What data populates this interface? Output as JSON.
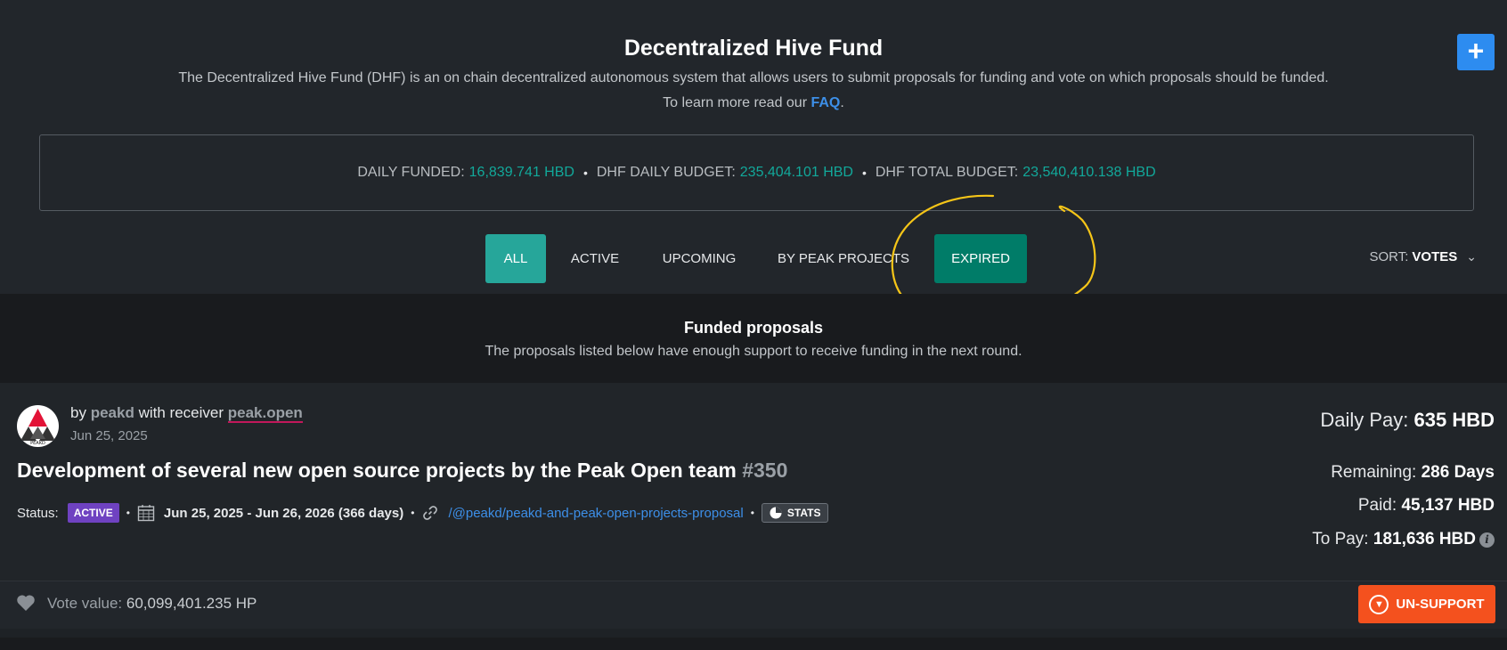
{
  "header": {
    "title": "Decentralized Hive Fund",
    "description": "The Decentralized Hive Fund (DHF) is an on chain decentralized autonomous system that allows users to submit proposals for funding and vote on which proposals should be funded.",
    "learn_prefix": "To learn more read our",
    "faq_label": "FAQ",
    "learn_suffix": ".",
    "add_label": "+"
  },
  "budget": {
    "daily_funded_label": "DAILY FUNDED:",
    "daily_funded_value": "16,839.741 HBD",
    "daily_budget_label": "DHF DAILY BUDGET:",
    "daily_budget_value": "235,404.101 HBD",
    "total_budget_label": "DHF TOTAL BUDGET:",
    "total_budget_value": "23,540,410.138 HBD",
    "separator": "•"
  },
  "tabs": {
    "all": "ALL",
    "active": "ACTIVE",
    "upcoming": "UPCOMING",
    "peak": "BY PEAK PROJECTS",
    "expired": "EXPIRED"
  },
  "sort": {
    "label": "SORT:",
    "value": "VOTES"
  },
  "funded": {
    "title": "Funded proposals",
    "description": "The proposals listed below have enough support to receive funding in the next round."
  },
  "proposal": {
    "by": "by",
    "author": "peakd",
    "with_receiver": "with receiver",
    "receiver": "peak.open",
    "date": "Jun 25, 2025",
    "title": "Development of several new open source projects by the Peak Open team",
    "number": "#350",
    "status_label": "Status:",
    "status": "ACTIVE",
    "date_range": "Jun 25, 2025 - Jun 26, 2026 (366 days)",
    "link": "/@peakd/peakd-and-peak-open-projects-proposal",
    "stats_label": "STATS",
    "daily_pay_label": "Daily Pay:",
    "daily_pay": "635 HBD",
    "remaining_label": "Remaining:",
    "remaining": "286 Days",
    "paid_label": "Paid:",
    "paid": "45,137 HBD",
    "to_pay_label": "To Pay:",
    "to_pay": "181,636 HBD",
    "avatar_text": "PEAKD"
  },
  "vote": {
    "label": "Vote value:",
    "value": "60,099,401.235 HP",
    "unsupport_label": "UN-SUPPORT"
  },
  "icons": {
    "add": "plus-icon",
    "sort": "chevron-down-icon",
    "calendar": "calendar-icon",
    "link": "link-icon",
    "stats": "pie-chart-icon",
    "info": "info-icon",
    "heart": "heart-icon",
    "unsupport": "chevron-down-circle-icon"
  },
  "colors": {
    "accent_teal": "#26a69a",
    "expired_teal": "#007c68",
    "value_teal": "#12a89a",
    "link_blue": "#3d8fe8",
    "add_blue": "#2d8cf0",
    "status_purple": "#6f42c1",
    "unsupport_orange": "#f4511e",
    "annotation_yellow": "#f5c518"
  }
}
